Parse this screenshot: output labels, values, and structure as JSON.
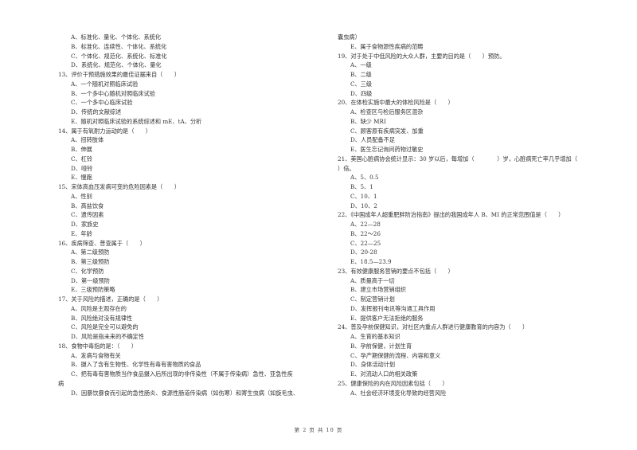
{
  "left_column": [
    {
      "type": "opt",
      "text": "A、标准化、量化、个体化、系统化"
    },
    {
      "type": "opt",
      "text": "B、标准化、连续性、个体化、系统化"
    },
    {
      "type": "opt",
      "text": "C、个体化、规范化、系统化、标准化"
    },
    {
      "type": "opt",
      "text": "D、系统化、规范化、个体化、量化"
    },
    {
      "type": "q",
      "text": "13、评价干预措施效果的最佳证据来自（　　）"
    },
    {
      "type": "opt",
      "text": "A、一个随机对照临床试验"
    },
    {
      "type": "opt",
      "text": "B、一个多中心随机对照临床试验"
    },
    {
      "type": "opt",
      "text": "C、一个多中心临床试验"
    },
    {
      "type": "opt",
      "text": "D、传统的文献综述"
    },
    {
      "type": "opt",
      "text": "E、随机对照临床试验的系统综述和 mE、tA、分析"
    },
    {
      "type": "q",
      "text": "14、属于有氧耐力运动的是（　　）"
    },
    {
      "type": "opt",
      "text": "A、扭转肢体"
    },
    {
      "type": "opt",
      "text": "B、伸展"
    },
    {
      "type": "opt",
      "text": "C、杠铃"
    },
    {
      "type": "opt",
      "text": "D、哑铃"
    },
    {
      "type": "opt",
      "text": "E、慢跑"
    },
    {
      "type": "q",
      "text": "15、宋体高血压发病可变的危险因素是（　　）"
    },
    {
      "type": "opt",
      "text": "A、性别"
    },
    {
      "type": "opt",
      "text": "B、高盐饮食"
    },
    {
      "type": "opt",
      "text": "C、遗传因素"
    },
    {
      "type": "opt",
      "text": "D、家族史"
    },
    {
      "type": "opt",
      "text": "E、年龄"
    },
    {
      "type": "q",
      "text": "16、疾病筛查、普查属于（　　）"
    },
    {
      "type": "opt",
      "text": "A、第二级预防"
    },
    {
      "type": "opt",
      "text": "B、第三级预防"
    },
    {
      "type": "opt",
      "text": "C、化学预防"
    },
    {
      "type": "opt",
      "text": "D、第一级预防"
    },
    {
      "type": "opt",
      "text": "E、三级预防策略"
    },
    {
      "type": "q",
      "text": "17、关于风险的描述，正确的是（　　）"
    },
    {
      "type": "opt",
      "text": "A、风险是主观存在的"
    },
    {
      "type": "opt",
      "text": "B、风险绝对没有规律性"
    },
    {
      "type": "opt",
      "text": "C、风险是完全可以避免的"
    },
    {
      "type": "opt",
      "text": "D、风险是指未来的不确定性"
    },
    {
      "type": "q",
      "text": "18、食物中毒指的是：（　　）"
    },
    {
      "type": "opt",
      "text": "A、发病与食物有关"
    },
    {
      "type": "opt",
      "text": "B、摄入了含有生物性、化学性有毒有害物质的食品"
    },
    {
      "type": "opt",
      "text": "C、把有毒有害物质当作食品摄入后所出现的非传染性（不属于传染病）急性、亚急性疾"
    },
    {
      "type": "q",
      "text": "病"
    },
    {
      "type": "opt",
      "text": "D、因暴饮暴食而引起的急性肠炎、食源性肠道传染病（如伤寒）和寄生虫病（如旋毛虫、"
    }
  ],
  "right_column": [
    {
      "type": "q",
      "text": "囊虫病）"
    },
    {
      "type": "opt",
      "text": "E、属于食物源性疾病的范畴"
    },
    {
      "type": "q",
      "text": "19、对于处于中低风险的大众人群，主要的目的是（　　）预防。"
    },
    {
      "type": "opt",
      "text": "A、一级"
    },
    {
      "type": "opt",
      "text": "B、二级"
    },
    {
      "type": "opt",
      "text": "C、三级"
    },
    {
      "type": "opt",
      "text": "D、四级"
    },
    {
      "type": "q",
      "text": "20、在体检实施中最大的体检风险是（　　）"
    },
    {
      "type": "opt",
      "text": "A、检查区与检后服务区混杂"
    },
    {
      "type": "opt",
      "text": "B、缺少 MRI"
    },
    {
      "type": "opt",
      "text": "C、顾客原有疾病突发、加重"
    },
    {
      "type": "opt",
      "text": "D、人员配备不足"
    },
    {
      "type": "opt",
      "text": "E、医生忘记询问药物过敏史"
    },
    {
      "type": "q",
      "text": "21、美国心脏病协会统计显示：30 岁以后，每增加（　　　　）岁，心脏病死亡率几乎增加（"
    },
    {
      "type": "q",
      "text": "）倍。"
    },
    {
      "type": "opt",
      "text": "A、5、0.5"
    },
    {
      "type": "opt",
      "text": "B、5、1"
    },
    {
      "type": "opt",
      "text": "C、10、1"
    },
    {
      "type": "opt",
      "text": "D、10、2"
    },
    {
      "type": "q",
      "text": "22、《中国成年人超重肥胖防治指南》提出的我国成年人 B、MI 的正常范围值是（　　）"
    },
    {
      "type": "opt",
      "text": "A、22—28"
    },
    {
      "type": "opt",
      "text": "B、22～26"
    },
    {
      "type": "opt",
      "text": "C、22—25"
    },
    {
      "type": "opt",
      "text": "D、20-28"
    },
    {
      "type": "opt",
      "text": "E、18.5—23.9"
    },
    {
      "type": "q",
      "text": "23、有效健康服务营销的要点不包括（　　）"
    },
    {
      "type": "opt",
      "text": "A、质量高于一切"
    },
    {
      "type": "opt",
      "text": "B、建立市场营销组织"
    },
    {
      "type": "opt",
      "text": "C、制定营销计划"
    },
    {
      "type": "opt",
      "text": "D、发挥报刊电讯等沟通工具作用"
    },
    {
      "type": "opt",
      "text": "E、提供客户无法拒绝的服务"
    },
    {
      "type": "q",
      "text": "24、普及孕前保健知识，对社区内重点人群进行健康教育的内容为（　　）"
    },
    {
      "type": "opt",
      "text": "A、生育的基本知识"
    },
    {
      "type": "opt",
      "text": "B、孕前保健，计划生育"
    },
    {
      "type": "opt",
      "text": "C、孕产期保健的流程、内容和意义"
    },
    {
      "type": "opt",
      "text": "D、身体活动计划"
    },
    {
      "type": "opt",
      "text": "E、对流动人口的相关政策"
    },
    {
      "type": "q",
      "text": "25、健康保险的内在风险因素包括（　　）"
    },
    {
      "type": "opt",
      "text": "A、社会经济环境变化导致的经营风险"
    }
  ],
  "footer": {
    "page_label": "第 2 页 共 10 页"
  }
}
